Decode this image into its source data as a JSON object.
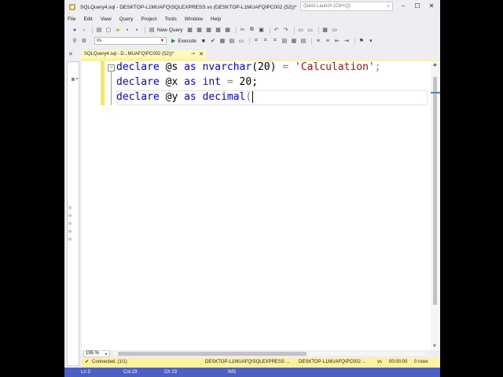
{
  "window": {
    "title": "SQLQuery4.sql - DESKTOP-L1MUAFQ\\SQLEXPRESS.vs (DESKTOP-L1MUAFQ\\PC002 (52))*",
    "quick_launch_placeholder": "Quick Launch (Ctrl+Q)"
  },
  "menu": [
    "File",
    "Edit",
    "View",
    "Query",
    "Project",
    "Tools",
    "Window",
    "Help"
  ],
  "toolbar": {
    "new_query": "New Query",
    "database": "vs",
    "execute": "Execute"
  },
  "tab": {
    "label": "SQLQuery4.sql - D...MUAFQ\\PC002 (52))*"
  },
  "editor": {
    "zoom": "195 %",
    "lines": [
      {
        "kw1": "declare",
        "var": " @s ",
        "kw2": "as",
        "type": " nvarchar",
        "rest": "(20) ",
        "op": "=",
        "str": " 'Calculation'",
        "end": ";"
      },
      {
        "kw1": "declare",
        "var": " @x ",
        "kw2": "as",
        "type": " int",
        "rest": " ",
        "op": "=",
        "str": "",
        "end": " 20;"
      },
      {
        "kw1": "declare",
        "var": " @y ",
        "kw2": "as",
        "type": " decimal",
        "rest": "",
        "op": "(",
        "str": "",
        "end": ""
      }
    ]
  },
  "query_status": {
    "connected": "Connected. (1/1)",
    "server": "DESKTOP-L1MUAFQ\\SQLEXPRESS ...",
    "user": "DESKTOP-L1MUAFQ\\PC002 ...",
    "database": "vs",
    "time": "00:00:00",
    "rows": "0 rows"
  },
  "status_bar": {
    "ln": "Ln 3",
    "col": "Col 23",
    "ch": "Ch 23",
    "mode": "INS"
  },
  "colors": {
    "keyword": "#0000ff",
    "string": "#a31515",
    "operator": "#808080",
    "tab_background": "#fffabf",
    "status_bar": "#4b5fc4"
  }
}
